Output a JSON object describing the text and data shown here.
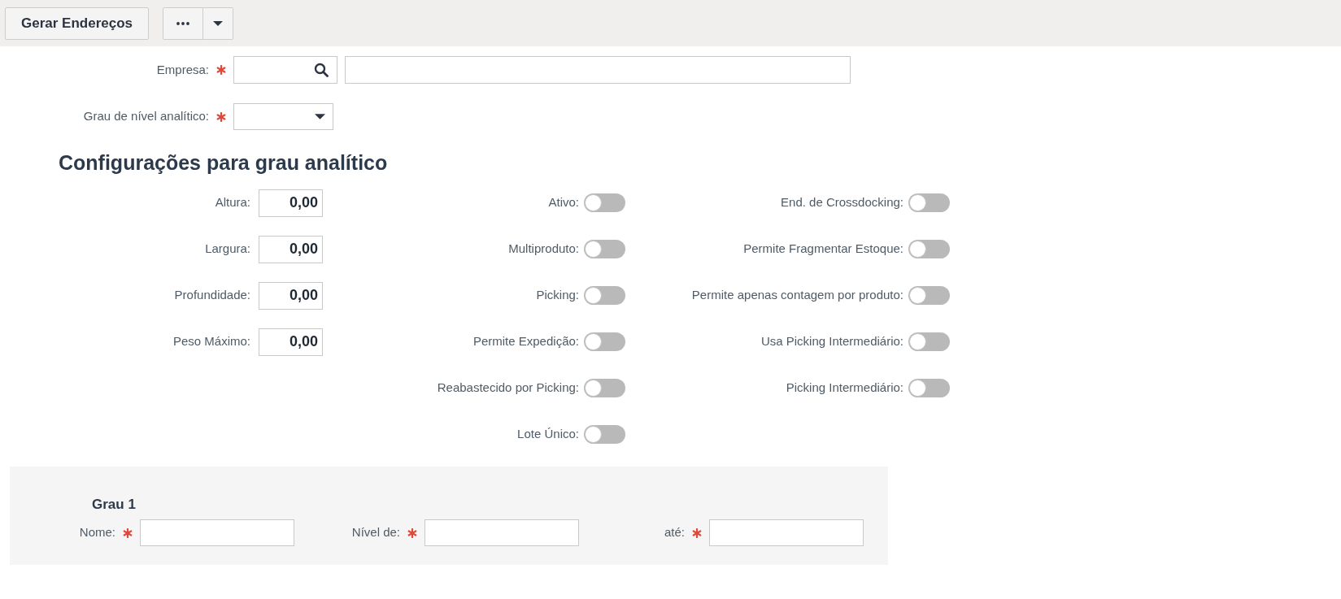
{
  "toolbar": {
    "primary_button": "Gerar Endereços"
  },
  "form": {
    "fields": [
      {
        "kind": "lookup",
        "label": "Empresa:",
        "required": true
      },
      {
        "kind": "select",
        "label": "Grau de nível analítico:",
        "required": true
      }
    ]
  },
  "config": {
    "title": "Configurações para grau analítico",
    "measures": [
      {
        "label": "Altura:",
        "value": "0,00"
      },
      {
        "label": "Largura:",
        "value": "0,00"
      },
      {
        "label": "Profundidade:",
        "value": "0,00"
      },
      {
        "label": "Peso Máximo:",
        "value": "0,00"
      }
    ],
    "toggles_left": [
      {
        "label": "Ativo:",
        "on": false
      },
      {
        "label": "Multiproduto:",
        "on": false
      },
      {
        "label": "Picking:",
        "on": false
      },
      {
        "label": "Permite Expedição:",
        "on": false
      },
      {
        "label": "Reabastecido por Picking:",
        "on": false
      },
      {
        "label": "Lote Único:",
        "on": false
      }
    ],
    "toggles_right": [
      {
        "label": "End. de Crossdocking:",
        "on": false
      },
      {
        "label": "Permite Fragmentar Estoque:",
        "on": false
      },
      {
        "label": "Permite apenas contagem por produto:",
        "on": false
      },
      {
        "label": "Usa Picking Intermediário:",
        "on": false
      },
      {
        "label": "Picking Intermediário:",
        "on": false
      }
    ]
  },
  "grade": {
    "title": "Grau 1",
    "fields": [
      {
        "label": "Nome:",
        "required": true
      },
      {
        "label": "Nível de:",
        "required": true
      },
      {
        "label": "até:",
        "required": true
      }
    ]
  }
}
